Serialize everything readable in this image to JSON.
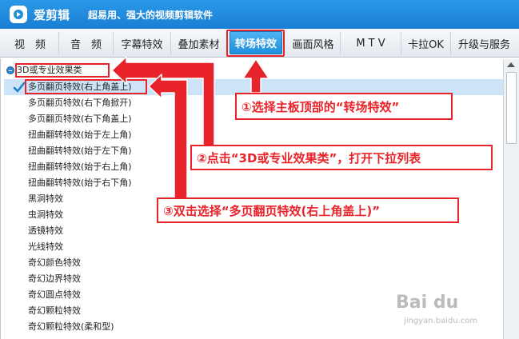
{
  "app": {
    "name": "爱剪辑",
    "slogan": "超易用、强大的视频剪辑软件"
  },
  "tabs": [
    {
      "label": "视　频",
      "active": false
    },
    {
      "label": "音　频",
      "active": false
    },
    {
      "label": "字幕特效",
      "active": false
    },
    {
      "label": "叠加素材",
      "active": false
    },
    {
      "label": "转场特效",
      "active": true
    },
    {
      "label": "画面风格",
      "active": false
    },
    {
      "label": "M T V",
      "active": false
    },
    {
      "label": "卡拉OK",
      "active": false
    },
    {
      "label": "升级与服务",
      "active": false
    }
  ],
  "category": {
    "label": "3D或专业效果类"
  },
  "items": [
    "多页翻页特效(右上角盖上)",
    "多页翻页特效(右下角掀开)",
    "多页翻页特效(右下角盖上)",
    "扭曲翻转特效(始于左上角)",
    "扭曲翻转特效(始于左下角)",
    "扭曲翻转特效(始于右上角)",
    "扭曲翻转特效(始于右下角)",
    "黑洞特效",
    "虫洞特效",
    "透镜特效",
    "光线特效",
    "奇幻颜色特效",
    "奇幻边界特效",
    "奇幻圆点特效",
    "奇幻颗粒特效",
    "奇幻颗粒特效(柔和型)"
  ],
  "callouts": {
    "step1": "①选择主板顶部的“转场特效”",
    "step2": "②点击“3D或专业效果类”，打开下拉列表",
    "step3": "③双击选择“多页翻页特效(右上角盖上)”"
  },
  "watermark": {
    "brand": "Bai du",
    "sub": "jingyan.baidu.com"
  },
  "colors": {
    "annotation": "#e8242a",
    "accent": "#1f8fdc",
    "selection": "#cde4f8"
  }
}
